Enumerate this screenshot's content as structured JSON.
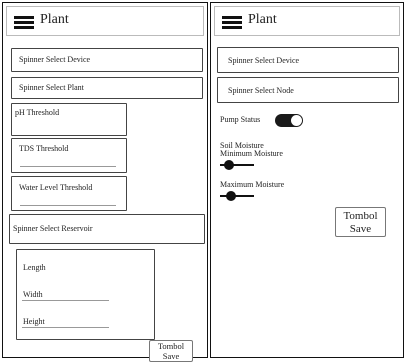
{
  "left": {
    "header": {
      "title": "Plant",
      "menu_icon": "hamburger-menu-icon"
    },
    "spinner_device": "Spinner Select Device",
    "spinner_plant": "Spinner Select Plant",
    "ph_threshold": "pH Threshold",
    "tds_threshold": "TDS Threshold",
    "water_level_threshold": "Water Level Threshold",
    "spinner_reservoir": "Spinner Select Reservoir",
    "length_label": "Length",
    "width_label": "Width",
    "height_label": "Height",
    "save_button": {
      "line1": "Tombol",
      "line2": "Save"
    }
  },
  "right": {
    "header": {
      "title": "Plant",
      "menu_icon": "hamburger-menu-icon"
    },
    "spinner_device": "Spinner Select Device",
    "spinner_node": "Spinner Select Node",
    "pump_status_label": "Pump Status",
    "pump_status_on": true,
    "soil_moisture_label": "Soil Moisture",
    "min_moisture_label": "Minimum Moisture",
    "min_moisture_value": 0.15,
    "max_moisture_label": "Maximum Moisture",
    "max_moisture_value": 0.25,
    "save_button": {
      "line1": "Tombol",
      "line2": "Save"
    }
  }
}
